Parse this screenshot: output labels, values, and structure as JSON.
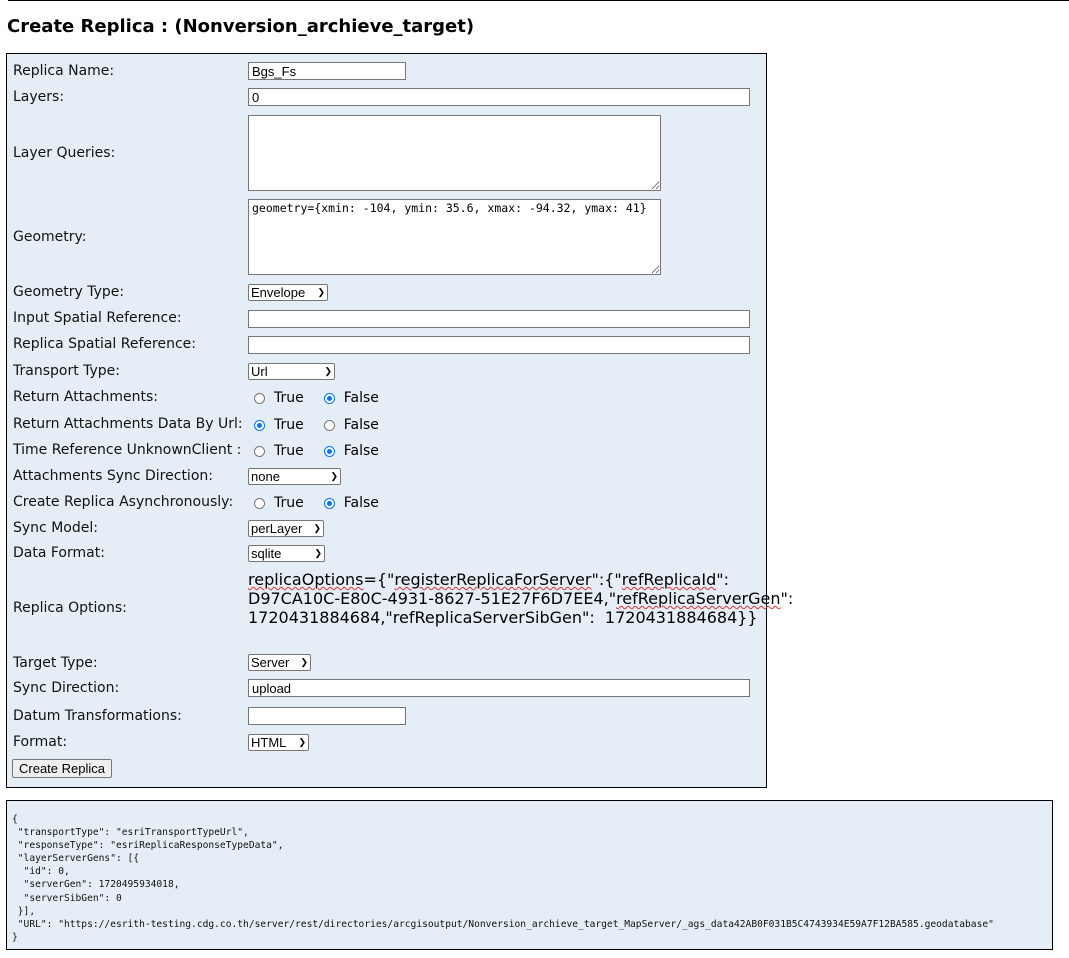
{
  "page": {
    "title": "Create Replica : (Nonversion_archieve_target)"
  },
  "form": {
    "replica_name": {
      "label": "Replica Name:",
      "value": "Bgs_Fs"
    },
    "layers": {
      "label": "Layers:",
      "value": "0"
    },
    "layer_queries": {
      "label": "Layer Queries:",
      "value": ""
    },
    "geometry": {
      "label": "Geometry:",
      "value": "geometry={xmin: -104, ymin: 35.6, xmax: -94.32, ymax: 41}"
    },
    "geometry_type": {
      "label": "Geometry Type:",
      "value": "Envelope"
    },
    "input_sr": {
      "label": "Input Spatial Reference:",
      "value": ""
    },
    "replica_sr": {
      "label": "Replica Spatial Reference:",
      "value": ""
    },
    "transport_type": {
      "label": "Transport Type:",
      "value": "Url"
    },
    "return_attachments": {
      "label": "Return Attachments:",
      "true_label": "True",
      "false_label": "False",
      "selected": "False"
    },
    "return_attachments_by_url": {
      "label": "Return Attachments Data By Url:",
      "true_label": "True",
      "false_label": "False",
      "selected": "True"
    },
    "time_ref_unknown_client": {
      "label": "Time Reference UnknownClient :",
      "true_label": "True",
      "false_label": "False",
      "selected": "False"
    },
    "attachments_sync_direction": {
      "label": "Attachments Sync Direction:",
      "value": "none"
    },
    "async": {
      "label": "Create Replica Asynchronously:",
      "true_label": "True",
      "false_label": "False",
      "selected": "False"
    },
    "sync_model": {
      "label": "Sync Model:",
      "value": "perLayer"
    },
    "data_format": {
      "label": "Data Format:",
      "value": "sqlite"
    },
    "replica_options": {
      "label": "Replica Options:",
      "line1_a": "replicaOptions",
      "line1_b": "={\"",
      "line1_c": "registerReplicaForServer",
      "line1_d": "\":{\"",
      "line1_e": "refReplicaId",
      "line1_f": "\":",
      "line2": "D97CA10C-E80C-4931-8627-51E27F6D7EE4,\"",
      "line2_b": "refReplicaServerGen",
      "line2_c": "\":",
      "line3": "1720431884684,\"refReplicaServerSibGen\":  1720431884684}}"
    },
    "target_type": {
      "label": "Target Type:",
      "value": "Server"
    },
    "sync_direction": {
      "label": "Sync Direction:",
      "value": "upload"
    },
    "datum_transformations": {
      "label": "Datum Transformations:",
      "value": ""
    },
    "format": {
      "label": "Format:",
      "value": "HTML"
    },
    "submit_label": "Create Replica"
  },
  "result": {
    "json_text": "{\n \"transportType\": \"esriTransportTypeUrl\",\n \"responseType\": \"esriReplicaResponseTypeData\",\n \"layerServerGens\": [{\n  \"id\": 0,\n  \"serverGen\": 1720495934018,\n  \"serverSibGen\": 0\n }],\n \"URL\": \"https://esrith-testing.cdg.co.th/server/rest/directories/arcgisoutput/Nonversion_archieve_target_MapServer/_ags_data42AB0F031B5C4743934E59A7F12BA585.geodatabase\"\n}"
  }
}
